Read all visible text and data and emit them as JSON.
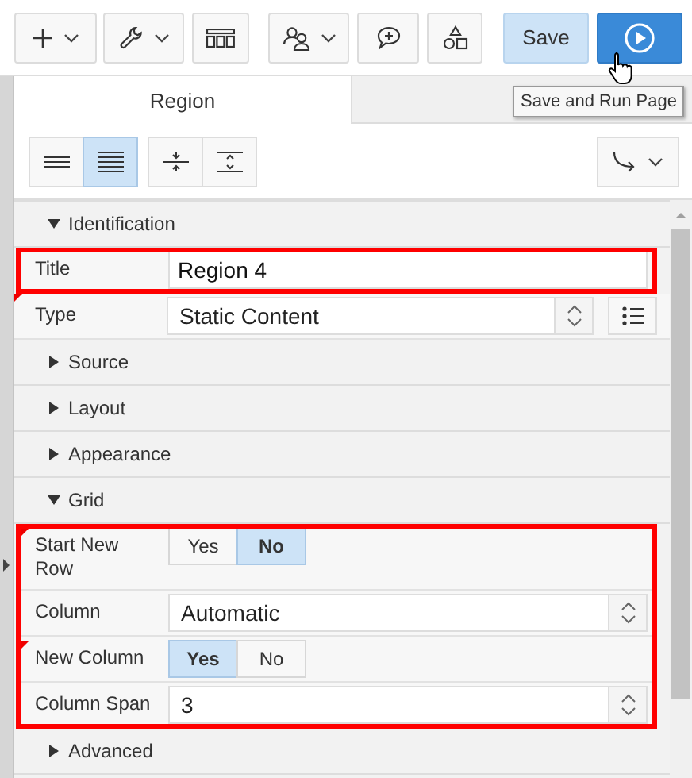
{
  "toolbar": {
    "save_label": "Save",
    "tooltip": "Save and Run Page"
  },
  "tabs": [
    {
      "label": "Region",
      "selected": true
    }
  ],
  "layout_toggles": [
    {
      "selected": false
    },
    {
      "selected": true
    },
    {
      "selected": false
    },
    {
      "selected": false
    }
  ],
  "sections": [
    {
      "title": "Identification",
      "expanded": true,
      "fields": [
        {
          "label": "Title",
          "kind": "text",
          "value": "Region 4",
          "highlighted": true,
          "flagged": false
        },
        {
          "label": "Type",
          "kind": "lov",
          "value": "Static Content",
          "highlighted": false,
          "flagged": true
        }
      ]
    },
    {
      "title": "Source",
      "expanded": false
    },
    {
      "title": "Layout",
      "expanded": false
    },
    {
      "title": "Appearance",
      "expanded": false
    },
    {
      "title": "Grid",
      "expanded": true,
      "fields": [
        {
          "label": "Start New Row",
          "kind": "yesno",
          "options": [
            {
              "label": "Yes",
              "selected": false
            },
            {
              "label": "No",
              "selected": true
            }
          ],
          "highlighted": true,
          "flagged": true
        },
        {
          "label": "Column",
          "kind": "select",
          "value": "Automatic",
          "highlighted": true,
          "flagged": false
        },
        {
          "label": "New Column",
          "kind": "yesno",
          "options": [
            {
              "label": "Yes",
              "selected": true
            },
            {
              "label": "No",
              "selected": false
            }
          ],
          "highlighted": true,
          "flagged": true
        },
        {
          "label": "Column Span",
          "kind": "select",
          "value": "3",
          "highlighted": true,
          "flagged": false
        }
      ]
    },
    {
      "title": "Advanced",
      "expanded": false
    }
  ]
}
